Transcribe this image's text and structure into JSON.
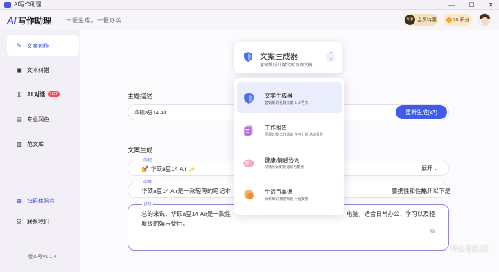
{
  "window": {
    "title": "AI写作助理"
  },
  "header": {
    "brand_ai": "AI",
    "brand_name": "写作助理",
    "slogan": "一键生成，一键办公",
    "vip_label": "VIP",
    "vip_text": "会员特惠",
    "points_text": "20 积分"
  },
  "sidebar": {
    "items": [
      {
        "label": "文案创作",
        "icon": "pen-icon"
      },
      {
        "label": "文本纠错",
        "icon": "doc-check-icon"
      },
      {
        "label": "AI 对话",
        "icon": "chat-icon",
        "badge": "HOT"
      },
      {
        "label": "专业润色",
        "icon": "polish-icon"
      },
      {
        "label": "范文库",
        "icon": "library-icon"
      },
      {
        "label": "扫码体验官",
        "icon": "qr-icon"
      },
      {
        "label": "联系我们",
        "icon": "headset-icon"
      }
    ],
    "version": "版本号V1.1.4"
  },
  "main": {
    "topic_label": "主题描述",
    "topic_value": "华硕a豆14 Air",
    "regen_button": "重新生成(x3)",
    "results_label": "文案生成",
    "results": [
      {
        "tag": "简短",
        "text": "💅 华硕a豆14 Air ✨",
        "expand": "展开"
      },
      {
        "tag": "中等",
        "text": "华硕a豆14 Air是一款轻薄的笔记本",
        "text_tail": "要携性和性能。以下是",
        "expand": "展开"
      }
    ],
    "detail": {
      "tag": "详尽",
      "line1_head": "总的来说，华硕a豆14 Air是一款性",
      "line1_tail": "电脑，适合日常办公、学习以及轻",
      "line2": "度级的娱乐使用。"
    }
  },
  "selector": {
    "title": "文案生成器",
    "subtitle": "营销策划 社媒文案 写作文稿"
  },
  "menu": {
    "items": [
      {
        "title": "文案生成器",
        "subtitle": "营销策划 社媒文案 公众号文",
        "selected": true
      },
      {
        "title": "工作报告",
        "subtitle": "周报日报 工作总结 任务分析 总结报告"
      },
      {
        "title": "健康/情感咨询",
        "subtitle": "情绪倾诉安抚 运动与健身"
      },
      {
        "title": "生活百事通",
        "subtitle": "百科知识 旅游规划 行程安排"
      }
    ]
  },
  "watermark": "什么值得买",
  "colors": {
    "accent": "#3e5ce8",
    "sidebar_bg": "#f2eff6",
    "selected_bg": "#e9edfc"
  }
}
